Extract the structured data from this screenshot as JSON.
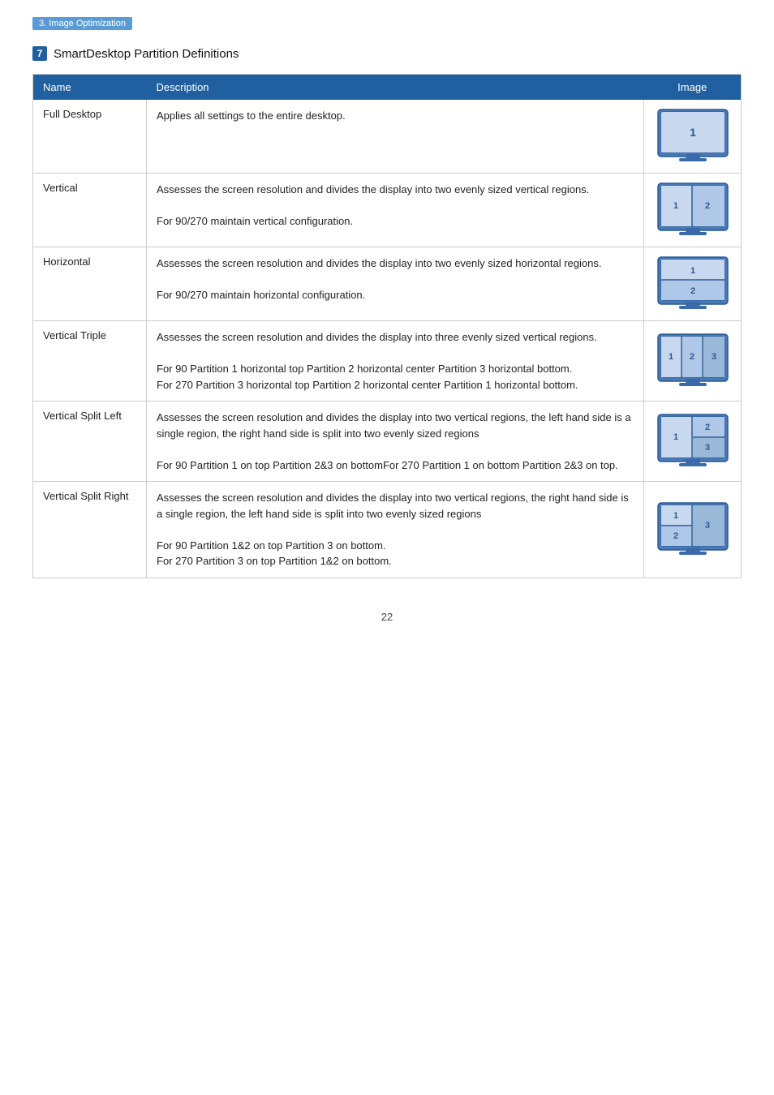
{
  "breadcrumb": "3. Image Optimization",
  "section": {
    "number": "7",
    "title": "SmartDesktop Partition Definitions"
  },
  "table": {
    "headers": [
      "Name",
      "Description",
      "Image"
    ],
    "rows": [
      {
        "name": "Full Desktop",
        "description": "Applies all settings to the entire desktop.",
        "layout": "full"
      },
      {
        "name": "Vertical",
        "description": "Assesses the screen resolution and divides the display into two evenly sized vertical regions.\n\nFor 90/270 maintain vertical configuration.",
        "layout": "vertical2"
      },
      {
        "name": "Horizontal",
        "description": "Assesses the screen resolution and divides the display into two evenly sized horizontal regions.\n\nFor 90/270 maintain horizontal configuration.",
        "layout": "horizontal2"
      },
      {
        "name": "Vertical Triple",
        "description": "Assesses the screen resolution and divides the display into three evenly sized vertical regions.\n\nFor 90 Partition 1 horizontal top Partition 2 horizontal center Partition 3 horizontal bottom.\nFor 270 Partition 3 horizontal top Partition 2 horizontal center Partition 1 horizontal bottom.",
        "layout": "vertical3"
      },
      {
        "name": "Vertical Split Left",
        "description": "Assesses the screen resolution and divides the display into two vertical regions, the left hand side is a single region, the right hand side is split into two evenly sized regions\n\nFor 90 Partition 1 on top Partition 2&3 on bottomFor 270 Partition 1 on bottom Partition 2&3 on top.",
        "layout": "splitLeft"
      },
      {
        "name": "Vertical Split Right",
        "description": "Assesses the screen resolution and divides the display into two vertical regions, the right  hand side is a single region, the left  hand side is split into two evenly sized regions\n\nFor 90 Partition 1&2  on top Partition 3 on bottom.\nFor 270 Partition 3 on top Partition 1&2 on bottom.",
        "layout": "splitRight"
      }
    ]
  },
  "page_number": "22"
}
